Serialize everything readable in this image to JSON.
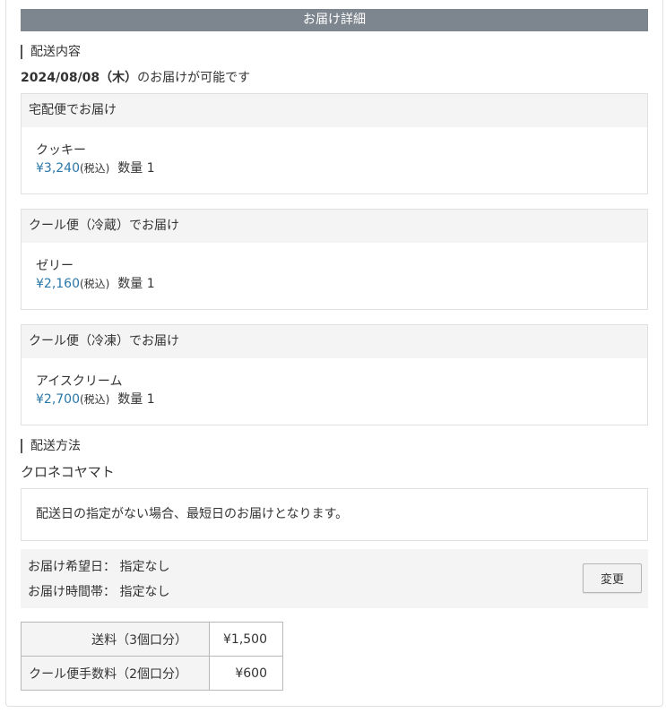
{
  "header": {
    "title": "お届け詳細"
  },
  "delivery_contents": {
    "section_label": "配送内容",
    "date": "2024/08/08（木）",
    "date_suffix": "のお届けが可能です",
    "shipments": [
      {
        "method": "宅配便でお届け",
        "item_name": "クッキー",
        "price": "¥3,240",
        "tax_label": "(税込)",
        "qty_label": "数量",
        "qty": "1"
      },
      {
        "method": "クール便（冷蔵）でお届け",
        "item_name": "ゼリー",
        "price": "¥2,160",
        "tax_label": "(税込)",
        "qty_label": "数量",
        "qty": "1"
      },
      {
        "method": "クール便（冷凍）でお届け",
        "item_name": "アイスクリーム",
        "price": "¥2,700",
        "tax_label": "(税込)",
        "qty_label": "数量",
        "qty": "1"
      }
    ]
  },
  "delivery_method": {
    "section_label": "配送方法",
    "carrier": "クロネコヤマト",
    "note": "配送日の指定がない場合、最短日のお届けとなります。",
    "preferred_date_label": "お届け希望日：",
    "preferred_date_value": "指定なし",
    "preferred_time_label": "お届け時間帯：",
    "preferred_time_value": "指定なし",
    "change_button": "変更"
  },
  "fees": [
    {
      "label": "送料（3個口分）",
      "value": "¥1,500"
    },
    {
      "label": "クール便手数料（2個口分）",
      "value": "¥600"
    }
  ],
  "colors": {
    "header_bg": "#7d868e",
    "price": "#2a77a8",
    "panel_bg": "#f4f4f4"
  }
}
